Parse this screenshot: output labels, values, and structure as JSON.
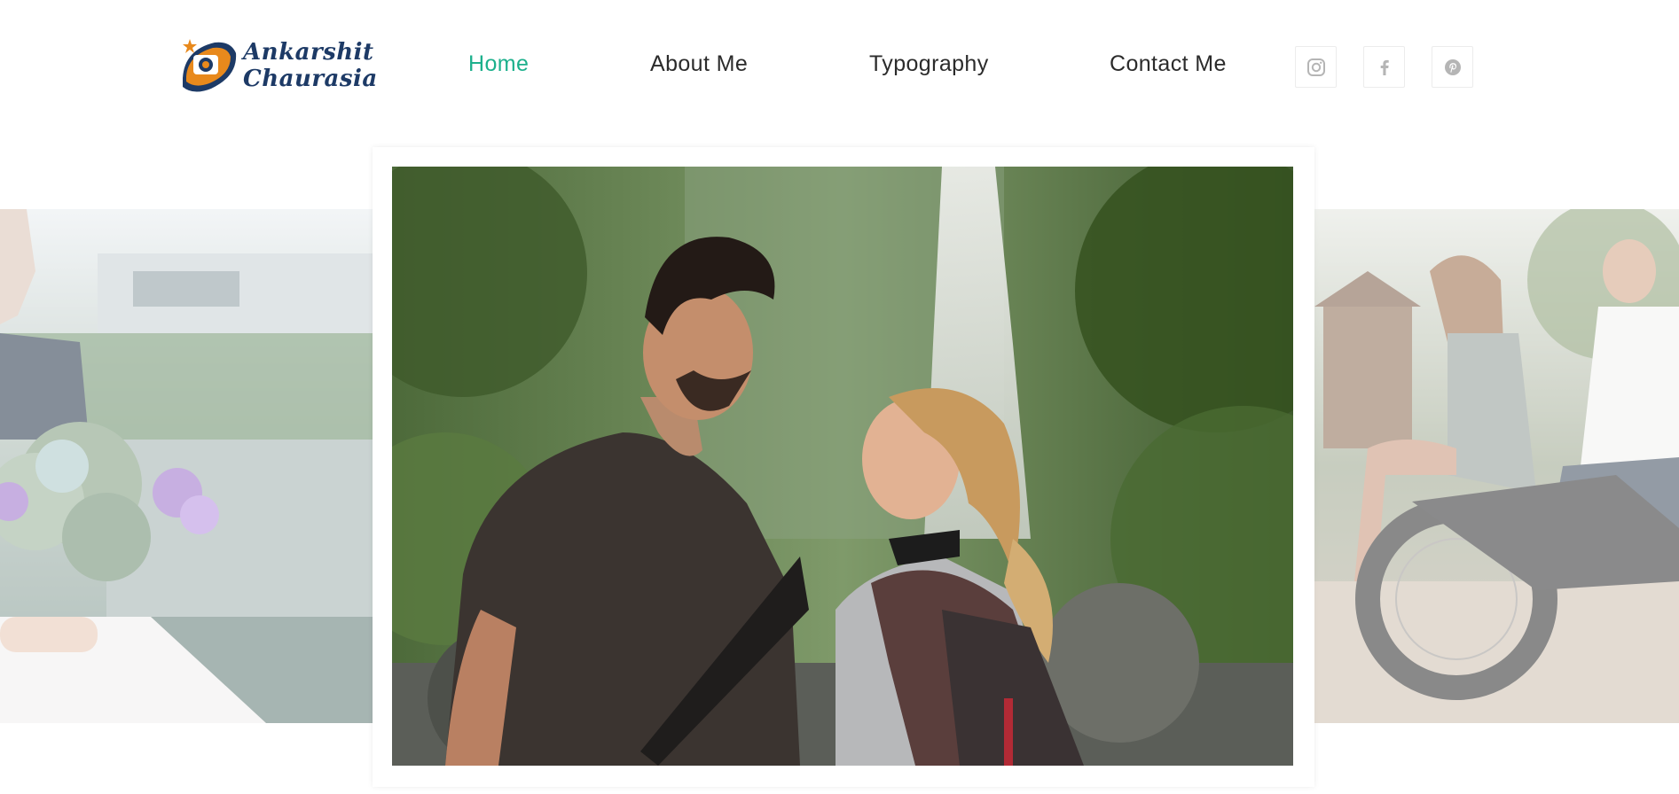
{
  "brand": {
    "name_line1": "Ankarshit",
    "name_line2": "Chaurasia",
    "colors": {
      "navy": "#1d3a66",
      "orange": "#e8891c"
    }
  },
  "nav": {
    "items": [
      {
        "label": "Home",
        "active": true
      },
      {
        "label": "About Me",
        "active": false
      },
      {
        "label": "Typography",
        "active": false
      },
      {
        "label": "Contact Me",
        "active": false
      }
    ],
    "active_color": "#1cb08c"
  },
  "social": [
    {
      "icon": "instagram-icon"
    },
    {
      "icon": "facebook-icon"
    },
    {
      "icon": "pinterest-icon"
    }
  ],
  "carousel": {
    "slides": [
      {
        "subject": "bride-bouquet"
      },
      {
        "subject": "couple-waterfall"
      },
      {
        "subject": "couple-motorcycle"
      }
    ],
    "active_index": 1
  }
}
